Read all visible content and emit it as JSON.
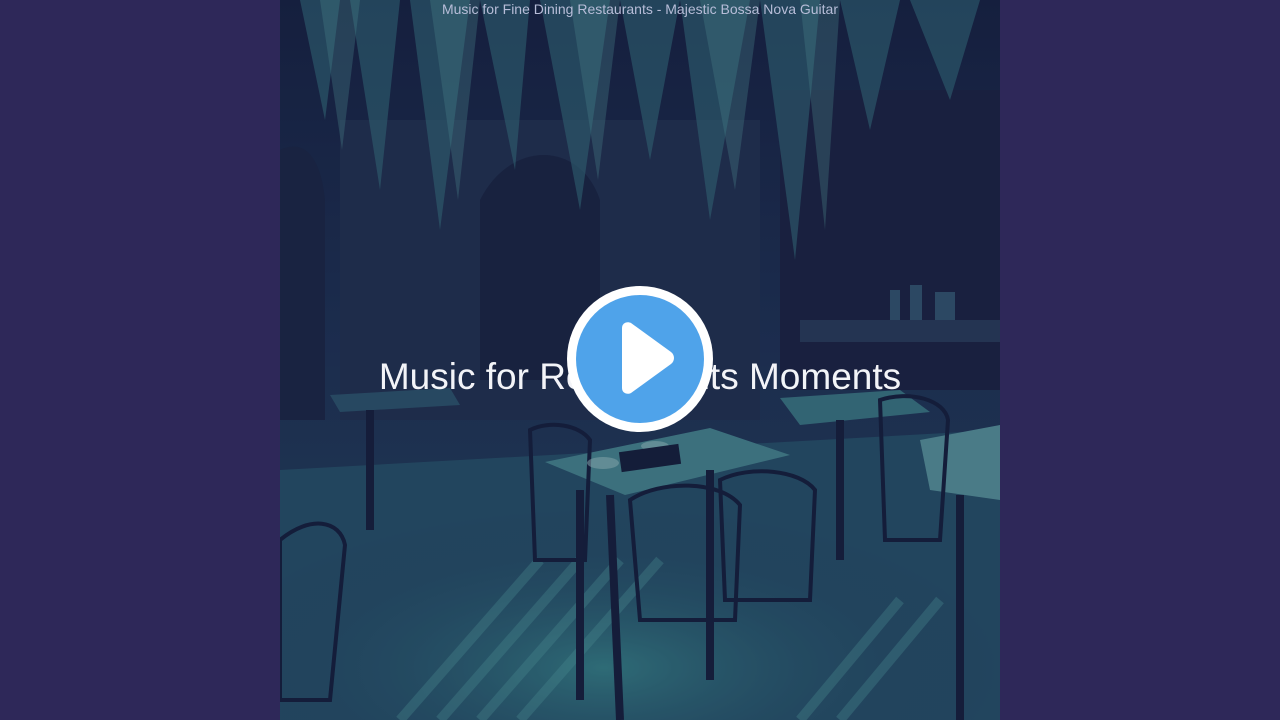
{
  "video": {
    "top_title": "Music for Fine Dining Restaurants - Majestic Bossa Nova Guitar",
    "overlay_title": "Music for Restaurants Moments"
  },
  "player": {
    "play_button_label": "Play",
    "play_icon": "play-icon"
  },
  "colors": {
    "background": "#2e2859",
    "play_fill": "#4fa3ea",
    "play_ring": "#ffffff",
    "artwork_tint": "#2f8d8b"
  }
}
